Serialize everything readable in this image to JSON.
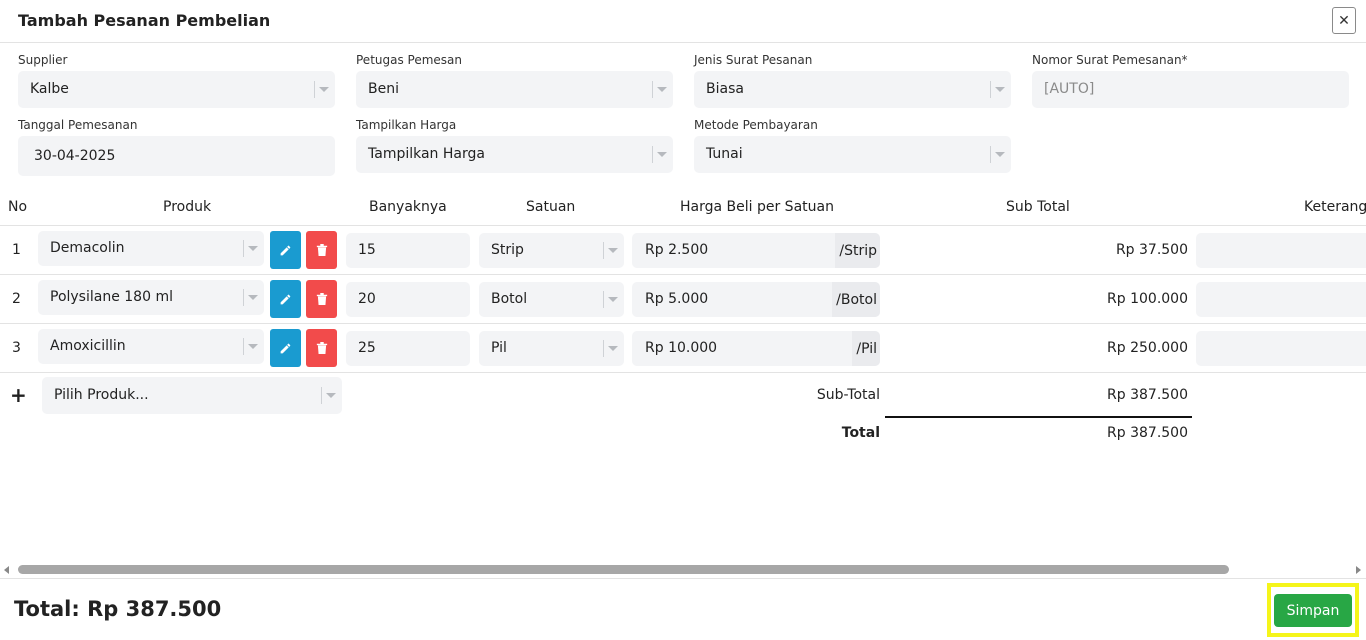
{
  "modal": {
    "title": "Tambah Pesanan Pembelian"
  },
  "form": {
    "supplier": {
      "label": "Supplier",
      "value": "Kalbe"
    },
    "petugas": {
      "label": "Petugas Pemesan",
      "value": "Beni"
    },
    "jenis": {
      "label": "Jenis Surat Pesanan",
      "value": "Biasa"
    },
    "nomor": {
      "label": "Nomor Surat Pemesanan*",
      "placeholder": "[AUTO]"
    },
    "tanggal": {
      "label": "Tanggal Pemesanan",
      "value": "30-04-2025"
    },
    "tampilkan": {
      "label": "Tampilkan Harga",
      "value": "Tampilkan Harga"
    },
    "metode": {
      "label": "Metode Pembayaran",
      "value": "Tunai"
    }
  },
  "table": {
    "headers": {
      "no": "No",
      "produk": "Produk",
      "banyaknya": "Banyaknya",
      "satuan": "Satuan",
      "harga": "Harga Beli per Satuan",
      "subtotal": "Sub Total",
      "keterangan": "Keterang"
    },
    "rows": [
      {
        "no": "1",
        "produk": "Demacolin",
        "qty": "15",
        "satuan": "Strip",
        "harga": "Rp 2.500",
        "unit": "/Strip",
        "subtotal": "Rp 37.500"
      },
      {
        "no": "2",
        "produk": "Polysilane 180 ml",
        "qty": "20",
        "satuan": "Botol",
        "harga": "Rp 5.000",
        "unit": "/Botol",
        "subtotal": "Rp 100.000"
      },
      {
        "no": "3",
        "produk": "Amoxicillin",
        "qty": "25",
        "satuan": "Pil",
        "harga": "Rp 10.000",
        "unit": "/Pil",
        "subtotal": "Rp 250.000"
      }
    ],
    "add_row": {
      "icon": "plus-icon",
      "placeholder": "Pilih Produk..."
    },
    "summary": {
      "subtotal_label": "Sub-Total",
      "subtotal_value": "Rp 387.500",
      "total_label": "Total",
      "total_value": "Rp 387.500"
    }
  },
  "footer": {
    "total_text": "Total: Rp 387.500",
    "save_label": "Simpan"
  },
  "colors": {
    "edit_button": "#1a9bd0",
    "delete_button": "#f24b4b",
    "save_button": "#28a745",
    "highlight": "#f5f51a"
  }
}
